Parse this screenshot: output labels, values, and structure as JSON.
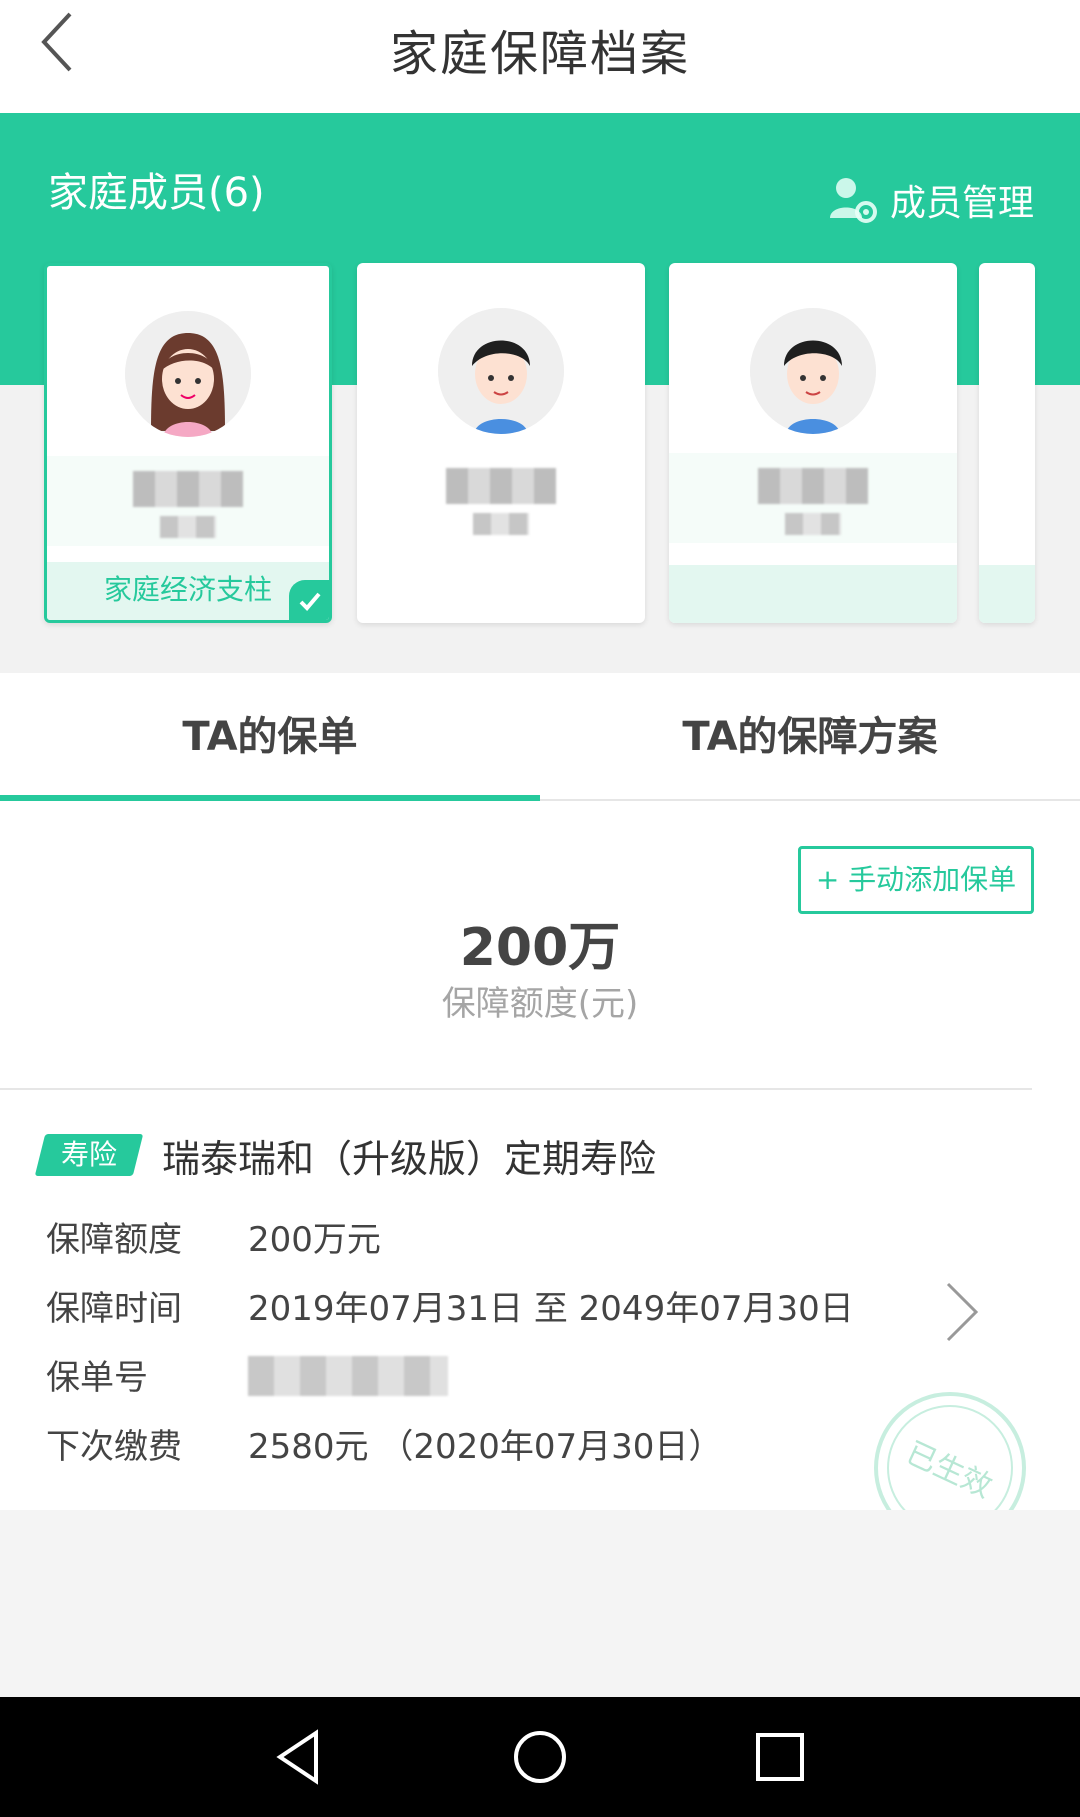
{
  "header": {
    "title": "家庭保障档案",
    "back_icon": "chevron-left-icon"
  },
  "members": {
    "title": "家庭成员(6)",
    "manage_label": "成员管理",
    "manage_icon": "user-gear-icon",
    "cards": [
      {
        "avatar": "female-avatar",
        "role": "家庭经济支柱",
        "selected": true
      },
      {
        "avatar": "male-avatar",
        "role": ""
      },
      {
        "avatar": "male-avatar",
        "role": ""
      }
    ]
  },
  "tabs": [
    {
      "label": "TA的保单",
      "active": true
    },
    {
      "label": "TA的保障方案",
      "active": false
    }
  ],
  "summary": {
    "add_button": "+ 手动添加保单",
    "amount": "200万",
    "amount_label": "保障额度(元)"
  },
  "policy": {
    "tag": "寿险",
    "name": "瑞泰瑞和（升级版）定期寿险",
    "fields": [
      {
        "key": "保障额度",
        "value": "200万元"
      },
      {
        "key": "保障时间",
        "value": "2019年07月31日 至 2049年07月30日"
      },
      {
        "key": "保单号",
        "value": ""
      },
      {
        "key": "下次缴费",
        "value": "2580元 （2020年07月30日）"
      }
    ],
    "stamp_text": "已生效"
  },
  "colors": {
    "accent": "#26c99c",
    "background": "#f4f4f4"
  }
}
